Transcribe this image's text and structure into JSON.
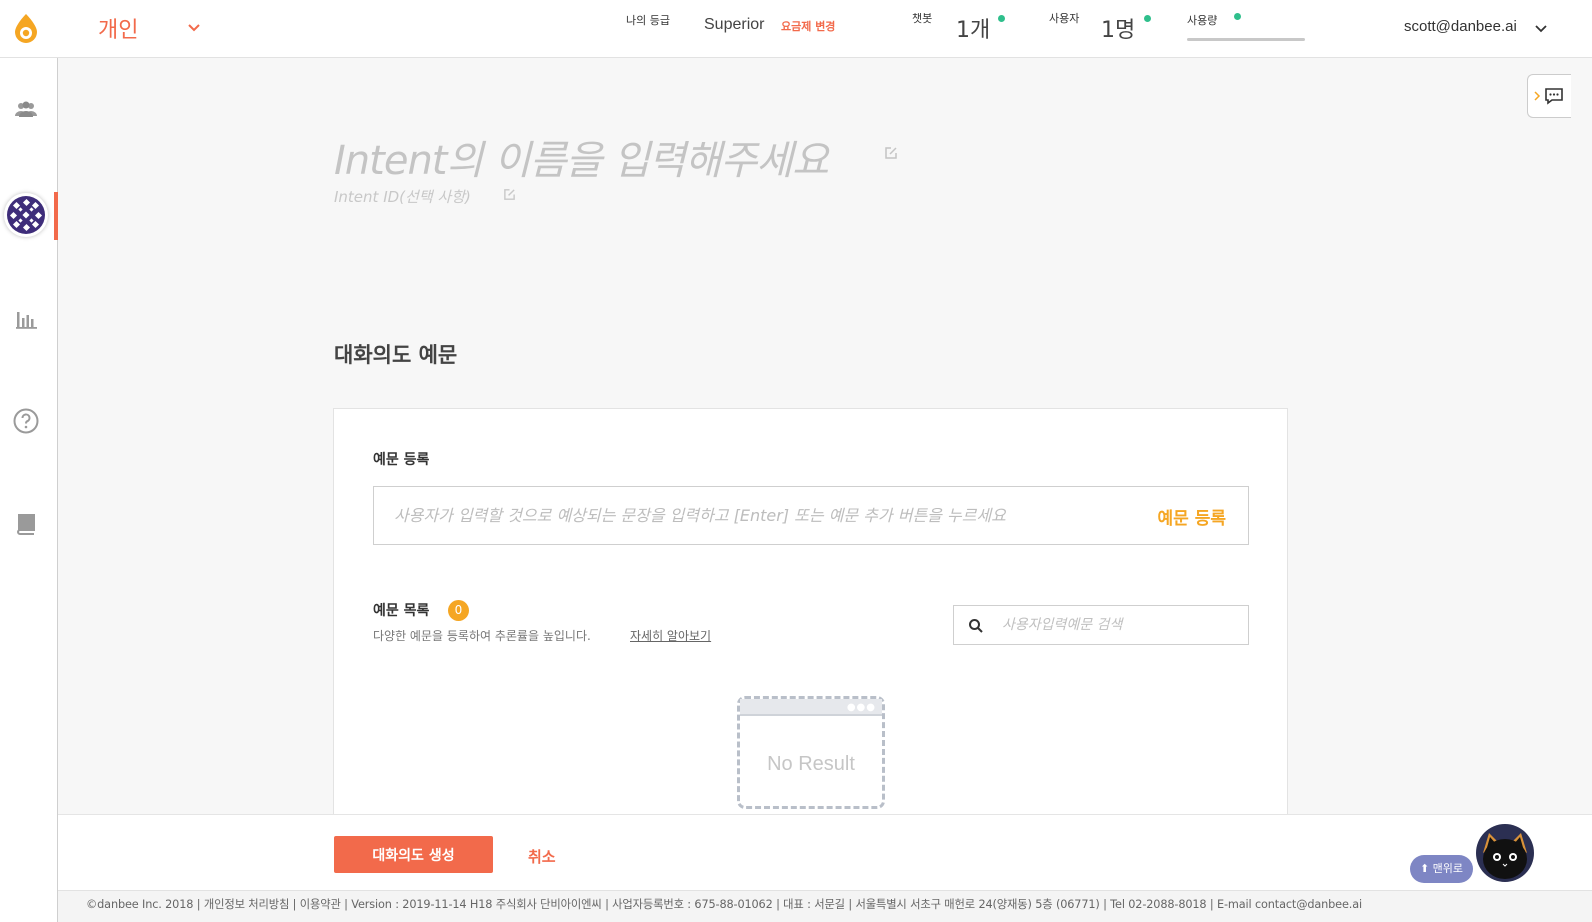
{
  "header": {
    "workspace": "개인",
    "grade_label": "나의 등급",
    "grade_value": "Superior",
    "plan_change": "요금제 변경",
    "chatbot_label": "챗봇",
    "chatbot_value": "1개",
    "user_label": "사용자",
    "user_value": "1명",
    "usage_label": "사용량",
    "email": "scott@danbee.ai"
  },
  "intent": {
    "name_placeholder": "Intent의 이름을 입력해주세요",
    "id_placeholder": "Intent ID(선택 사항)"
  },
  "section": {
    "title": "대화의도 예문"
  },
  "register": {
    "label": "예문 등록",
    "placeholder": "사용자가 입력할 것으로 예상되는 문장을 입력하고 [Enter] 또는 예문 추가 버튼을 누르세요",
    "button": "예문 등록"
  },
  "list": {
    "label": "예문 목록",
    "count": "0",
    "description": "다양한 예문을 등록하여 추론률을 높입니다.",
    "learn_more": "자세히 알아보기",
    "search_placeholder": "사용자입력예문 검색",
    "empty_text": "No Result"
  },
  "actions": {
    "create": "대화의도 생성",
    "cancel": "취소",
    "to_top": "⬆ 맨위로"
  },
  "footer": {
    "text": "©danbee Inc. 2018 | 개인정보 처리방침 | 이용약관 | Version : 2019-11-14  H18     주식회사 단비아이엔씨 | 사업자등록번호 : 675-88-01062 | 대표 : 서문길 | 서울특별시 서초구 매헌로 24(양재동) 5층 (06771) | Tel 02-2088-8018 | E-mail contact@danbee.ai"
  },
  "colors": {
    "accent": "#f26a4b",
    "orange": "#f5a623",
    "status_green": "#2fbf8c",
    "sidebar_icon": "#9a9a9a",
    "top_button": "#7e86c4"
  },
  "icons": [
    "danbee-logo-icon",
    "chevron-down-icon",
    "users-icon",
    "pattern-icon",
    "bar-chart-icon",
    "help-icon",
    "book-icon",
    "chat-bubble-icon",
    "edit-icon",
    "search-icon",
    "cat-avatar-icon"
  ]
}
